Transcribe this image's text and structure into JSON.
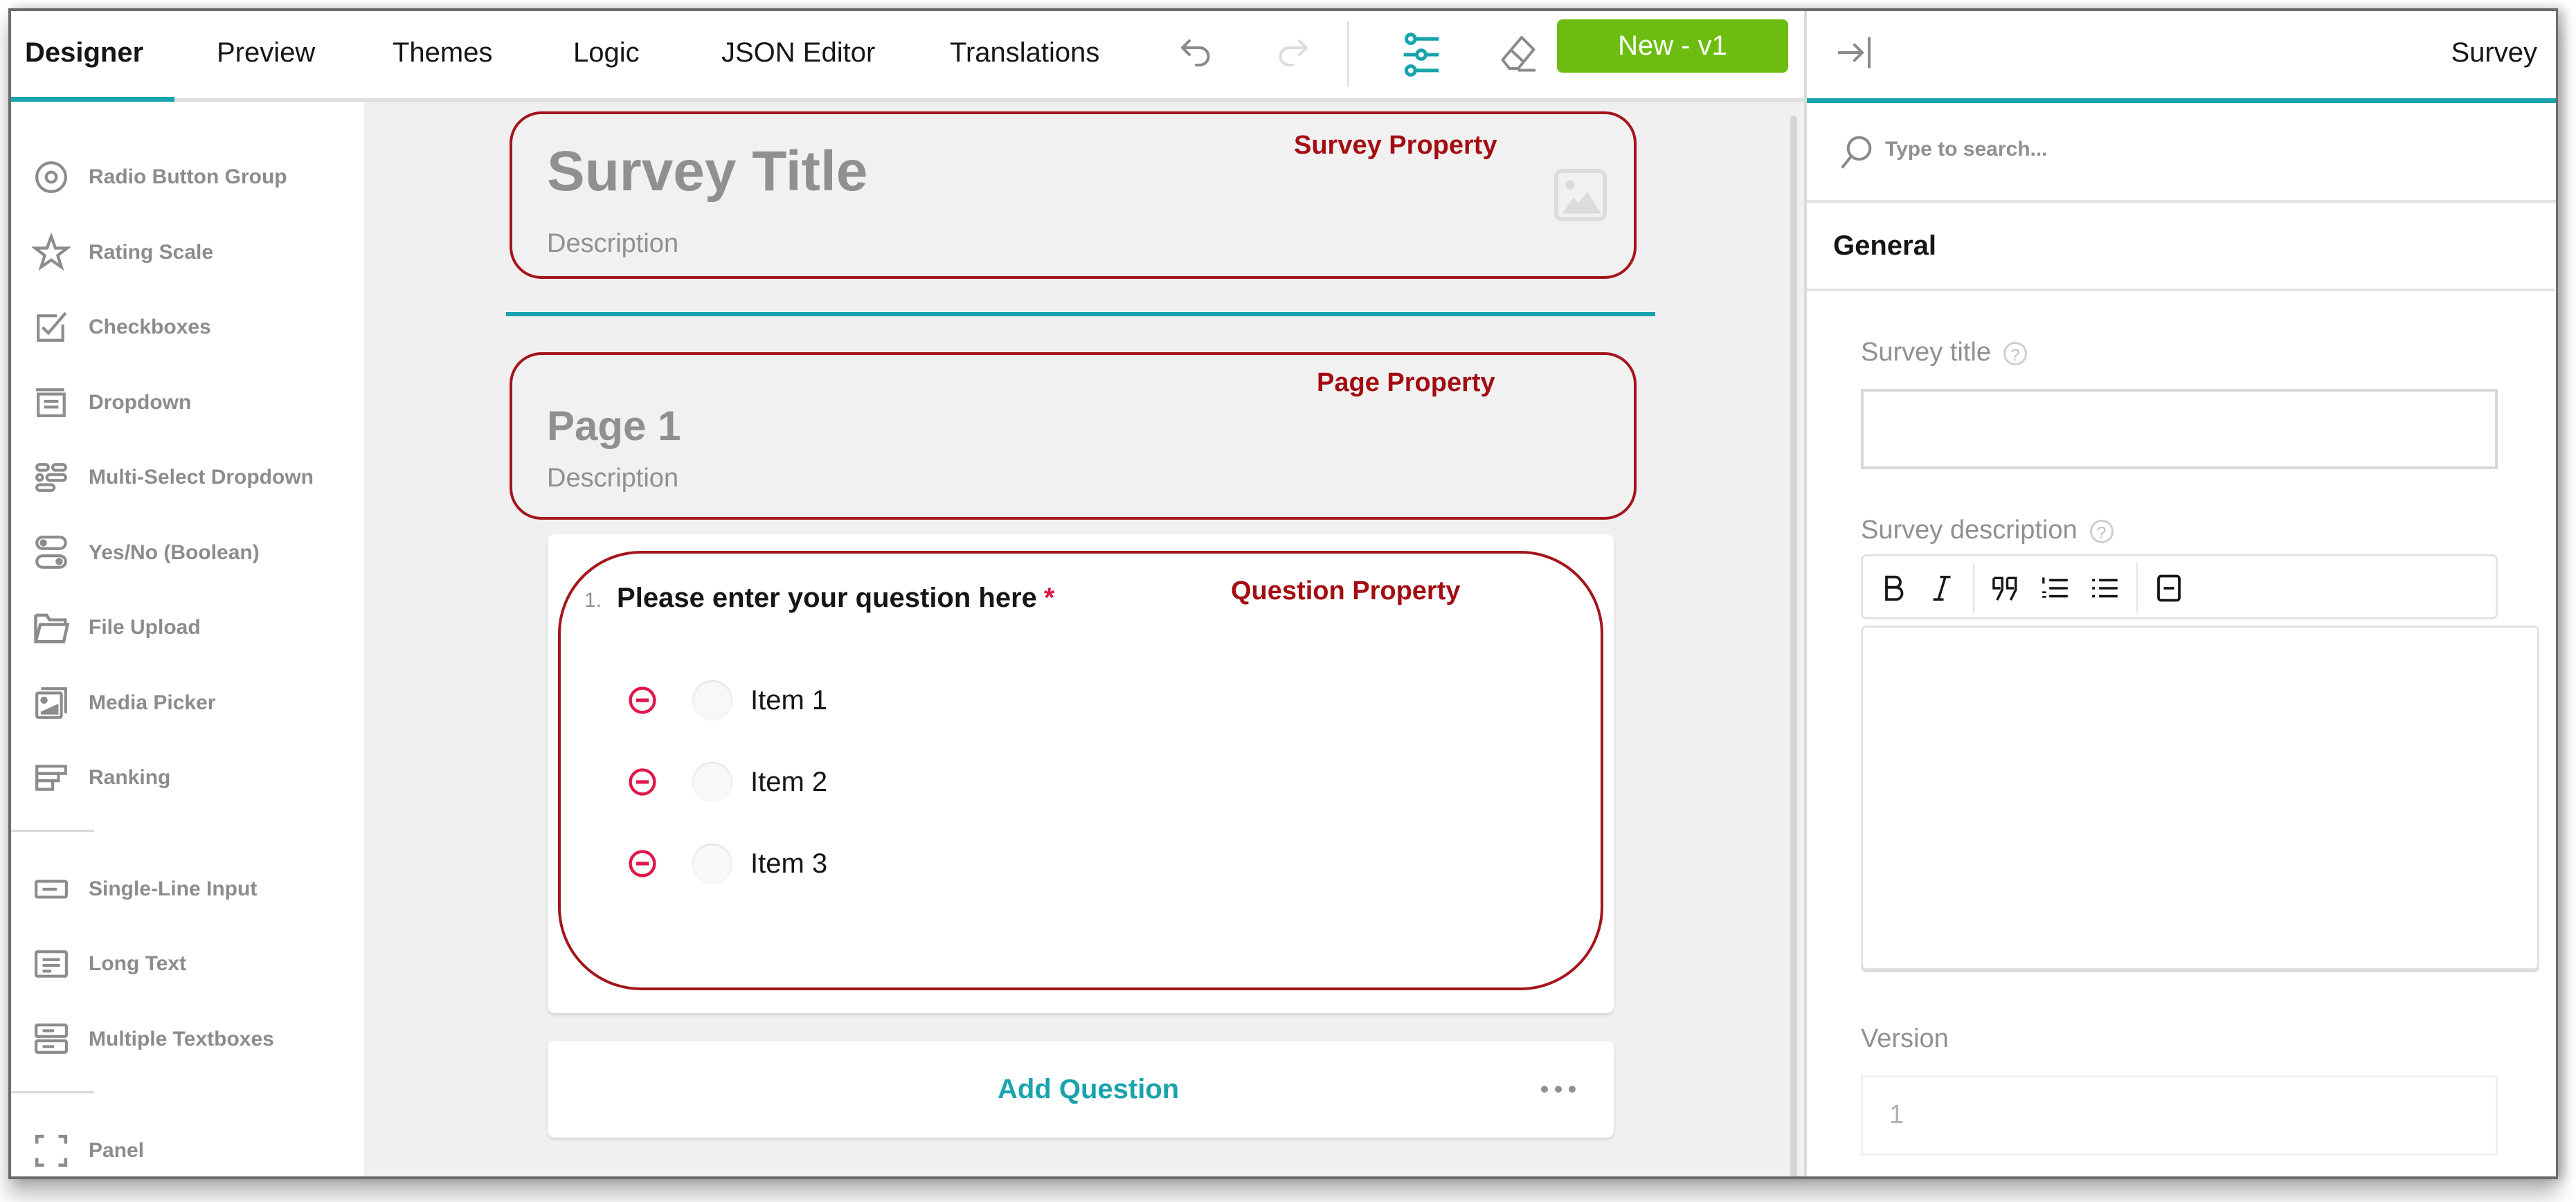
{
  "toolbar": {
    "tabs": [
      {
        "label": "Designer",
        "active": true
      },
      {
        "label": "Preview",
        "active": false
      },
      {
        "label": "Themes",
        "active": false
      },
      {
        "label": "Logic",
        "active": false
      },
      {
        "label": "JSON Editor",
        "active": false
      },
      {
        "label": "Translations",
        "active": false
      }
    ],
    "icons": {
      "undo": "undo-icon",
      "redo": "redo-icon",
      "settings": "settings-sliders-icon",
      "clear": "eraser-icon"
    },
    "version_button": "New - v1",
    "accent_color": "#19a3ad",
    "button_color": "#6cbd0f"
  },
  "sidebar": {
    "groups": [
      [
        {
          "label": "Radio Button Group",
          "icon": "radio-icon"
        },
        {
          "label": "Rating Scale",
          "icon": "star-icon"
        },
        {
          "label": "Checkboxes",
          "icon": "checkbox-icon"
        },
        {
          "label": "Dropdown",
          "icon": "dropdown-icon"
        },
        {
          "label": "Multi-Select Dropdown",
          "icon": "tagbox-icon"
        },
        {
          "label": "Yes/No (Boolean)",
          "icon": "toggle-icon"
        },
        {
          "label": "File Upload",
          "icon": "folder-icon"
        },
        {
          "label": "Media Picker",
          "icon": "image-picker-icon"
        },
        {
          "label": "Ranking",
          "icon": "ranking-icon"
        }
      ],
      [
        {
          "label": "Single-Line Input",
          "icon": "text-input-icon"
        },
        {
          "label": "Long Text",
          "icon": "comment-icon"
        },
        {
          "label": "Multiple Textboxes",
          "icon": "multiple-text-icon"
        }
      ],
      [
        {
          "label": "Panel",
          "icon": "panel-icon"
        }
      ]
    ]
  },
  "canvas": {
    "survey": {
      "title": "Survey Title",
      "description": "Description",
      "annotation": "Survey Property",
      "logo_icon": "image-placeholder-icon"
    },
    "page": {
      "title": "Page 1",
      "description": "Description",
      "annotation": "Page Property"
    },
    "question": {
      "number": "1.",
      "title": "Please enter your question here",
      "required_mark": "*",
      "annotation": "Question Property",
      "choices": [
        "Item 1",
        "Item 2",
        "Item 3"
      ]
    },
    "add_question": "Add Question",
    "annotation_color": "#a30d12"
  },
  "property_panel": {
    "title": "Survey",
    "collapse_icon": "collapse-panel-icon",
    "search_placeholder": "Type to search...",
    "section": "General",
    "fields": {
      "survey_title": {
        "label": "Survey title",
        "value": ""
      },
      "survey_description": {
        "label": "Survey description",
        "value": ""
      },
      "version": {
        "label": "Version",
        "value": "1"
      }
    },
    "rte_buttons": [
      "bold-icon",
      "italic-icon",
      "quote-icon",
      "numbered-list-icon",
      "bulleted-list-icon",
      "horizontal-rule-icon"
    ]
  }
}
